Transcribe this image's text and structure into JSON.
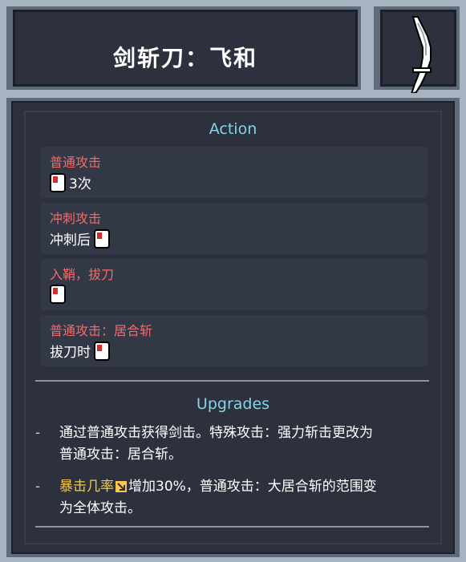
{
  "item": {
    "title": "剑斩刀：飞和",
    "icon": "curved-blade-icon"
  },
  "action": {
    "heading": "Action",
    "entries": [
      {
        "title": "普通攻击",
        "line_prefix": "",
        "line_suffix": "3次",
        "button_icon": "attack-button-icon"
      },
      {
        "title": "冲刺攻击",
        "line_prefix": "冲刺后",
        "line_suffix": "",
        "button_icon": "attack-button-icon"
      },
      {
        "title": "入鞘，拔刀",
        "line_prefix": "",
        "line_suffix": "",
        "button_icon": "attack-button-icon"
      },
      {
        "title": "普通攻击：居合斩",
        "line_prefix": "拔刀时",
        "line_suffix": "",
        "button_icon": "attack-button-icon"
      }
    ]
  },
  "upgrades": {
    "heading": "Upgrades",
    "items": [
      {
        "dash": "-",
        "line1": "通过普通攻击获得剑击。特殊攻击：强力斩击更改为",
        "line2": "普通攻击：居合斩。"
      },
      {
        "dash": "-",
        "highlight": "暴击几率",
        "highlight_icon": "crit-arrow-icon",
        "line1_rest": "增加30%，普通攻击：大居合斩的范围变",
        "line2": "为全体攻击。"
      }
    ]
  },
  "colors": {
    "panel_light": "#a7b3c1",
    "panel_dark": "#2c313d",
    "accent_cyan": "#84d4e6",
    "accent_red": "#f46a6a",
    "accent_yellow": "#f5c84b"
  }
}
